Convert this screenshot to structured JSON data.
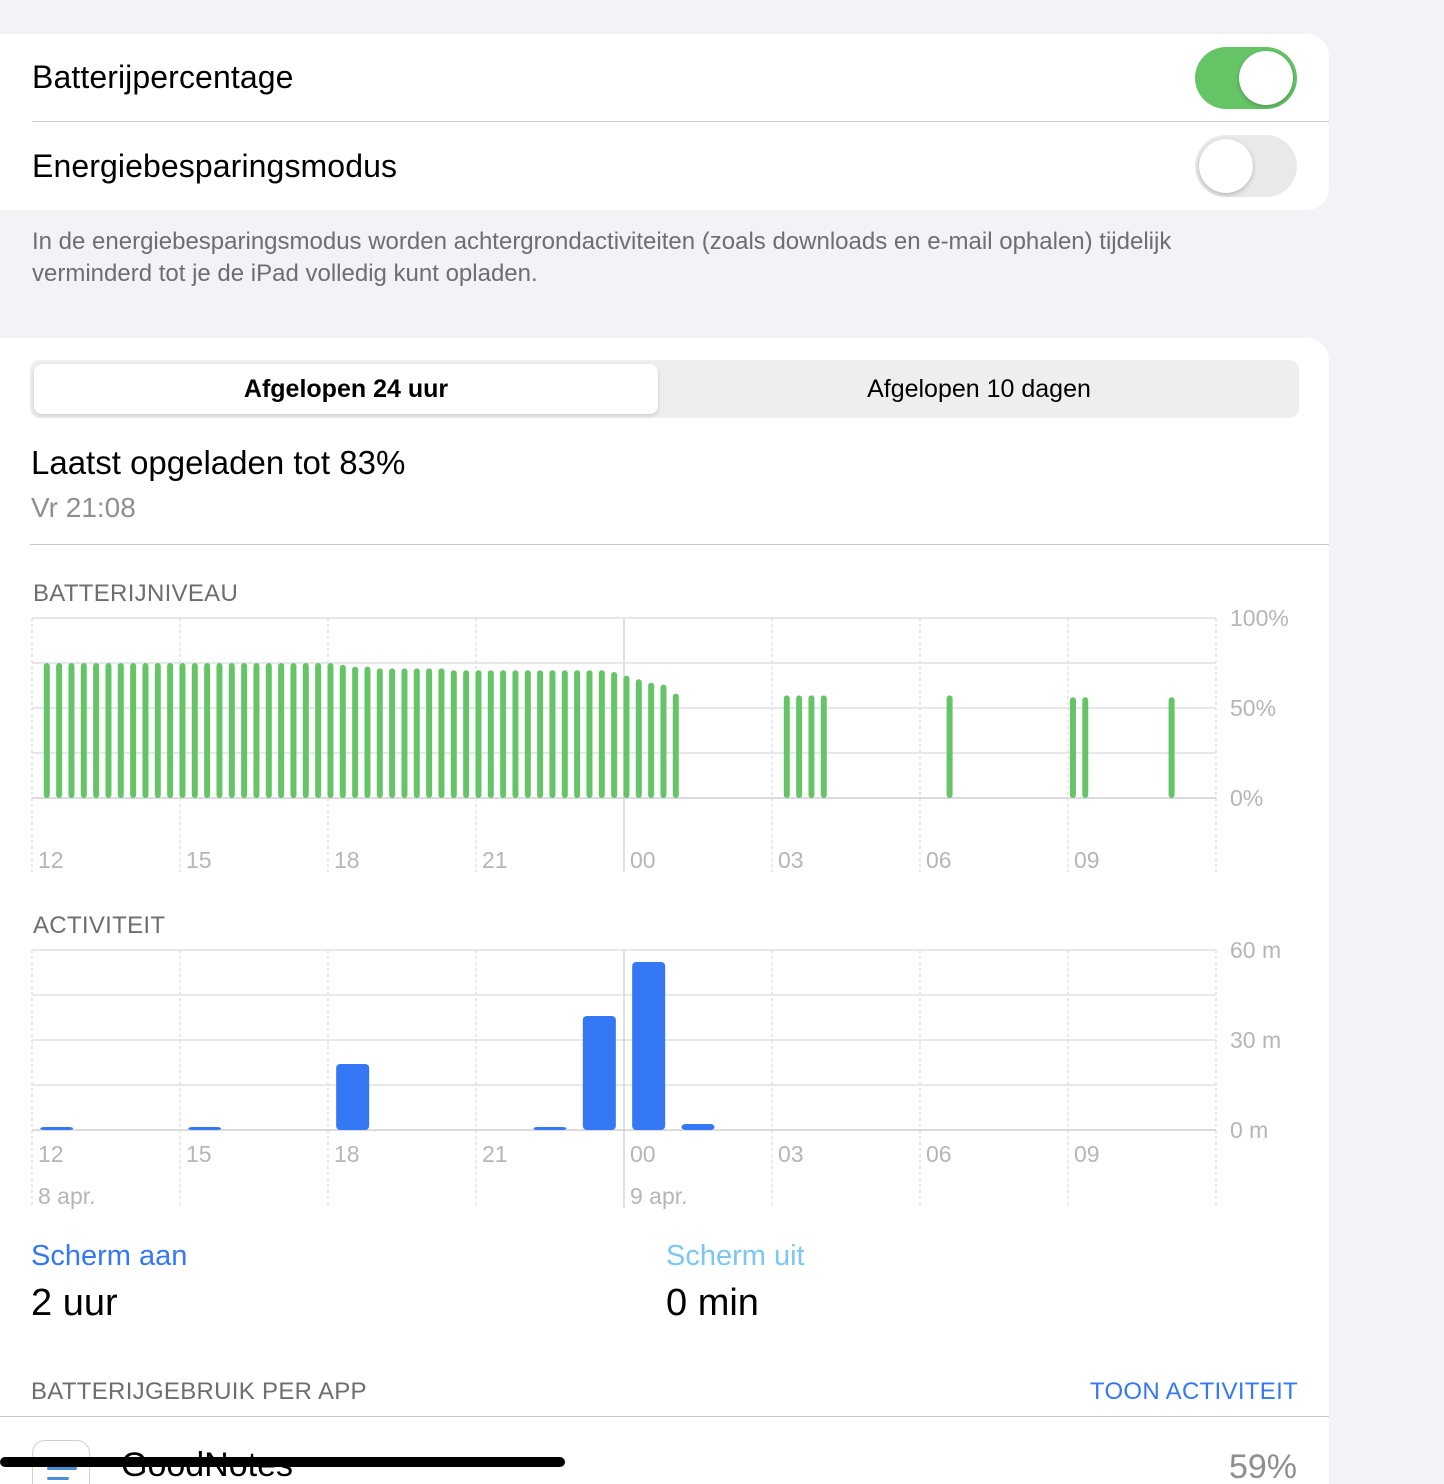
{
  "settings": {
    "battery_percentage": {
      "label": "Batterijpercentage",
      "enabled": true
    },
    "low_power_mode": {
      "label": "Energiebesparingsmodus",
      "enabled": false
    },
    "footnote": "In de energiebesparingsmodus worden achtergrondactiviteiten (zoals downloads en e-mail ophalen) tijdelijk verminderd tot je de iPad volledig kunt opladen."
  },
  "segmented": {
    "options": [
      "Afgelopen 24 uur",
      "Afgelopen 10 dagen"
    ],
    "selected": "Afgelopen 24 uur"
  },
  "last_charge": {
    "title": "Laatst opgeladen tot 83%",
    "time": "Vr 21:08"
  },
  "colors": {
    "battery_bar": "#65c466",
    "activity_bar": "#3478f6",
    "screen_on": "#3478f6",
    "screen_off": "#7cc6f5",
    "link": "#3478f6"
  },
  "chart_data": [
    {
      "type": "bar",
      "title": "BATTERIJNIVEAU",
      "x_ticks": [
        "12",
        "15",
        "18",
        "21",
        "00",
        "03",
        "06",
        "09"
      ],
      "y_ticks": [
        "100%",
        "50%",
        "0%"
      ],
      "ylim": [
        0,
        100
      ],
      "x_unit": "hours since 12:00",
      "grid": true,
      "points": [
        {
          "x": 0.3,
          "y": 75
        },
        {
          "x": 0.55,
          "y": 75
        },
        {
          "x": 0.8,
          "y": 75
        },
        {
          "x": 1.05,
          "y": 75
        },
        {
          "x": 1.3,
          "y": 75
        },
        {
          "x": 1.55,
          "y": 75
        },
        {
          "x": 1.8,
          "y": 75
        },
        {
          "x": 2.05,
          "y": 75
        },
        {
          "x": 2.3,
          "y": 75
        },
        {
          "x": 2.55,
          "y": 75
        },
        {
          "x": 2.8,
          "y": 75
        },
        {
          "x": 3.05,
          "y": 75
        },
        {
          "x": 3.3,
          "y": 75
        },
        {
          "x": 3.55,
          "y": 75
        },
        {
          "x": 3.8,
          "y": 75
        },
        {
          "x": 4.05,
          "y": 75
        },
        {
          "x": 4.3,
          "y": 75
        },
        {
          "x": 4.55,
          "y": 75
        },
        {
          "x": 4.8,
          "y": 75
        },
        {
          "x": 5.05,
          "y": 75
        },
        {
          "x": 5.3,
          "y": 75
        },
        {
          "x": 5.55,
          "y": 75
        },
        {
          "x": 5.8,
          "y": 75
        },
        {
          "x": 6.05,
          "y": 75
        },
        {
          "x": 6.3,
          "y": 74
        },
        {
          "x": 6.55,
          "y": 73
        },
        {
          "x": 6.8,
          "y": 73
        },
        {
          "x": 7.05,
          "y": 72
        },
        {
          "x": 7.3,
          "y": 72
        },
        {
          "x": 7.55,
          "y": 72
        },
        {
          "x": 7.8,
          "y": 72
        },
        {
          "x": 8.05,
          "y": 72
        },
        {
          "x": 8.3,
          "y": 72
        },
        {
          "x": 8.55,
          "y": 71
        },
        {
          "x": 8.8,
          "y": 71
        },
        {
          "x": 9.05,
          "y": 71
        },
        {
          "x": 9.3,
          "y": 71
        },
        {
          "x": 9.55,
          "y": 71
        },
        {
          "x": 9.8,
          "y": 71
        },
        {
          "x": 10.05,
          "y": 71
        },
        {
          "x": 10.3,
          "y": 71
        },
        {
          "x": 10.55,
          "y": 71
        },
        {
          "x": 10.8,
          "y": 71
        },
        {
          "x": 11.05,
          "y": 71
        },
        {
          "x": 11.3,
          "y": 71
        },
        {
          "x": 11.55,
          "y": 71
        },
        {
          "x": 11.8,
          "y": 70
        },
        {
          "x": 12.05,
          "y": 68
        },
        {
          "x": 12.3,
          "y": 66
        },
        {
          "x": 12.55,
          "y": 64
        },
        {
          "x": 12.8,
          "y": 63
        },
        {
          "x": 13.05,
          "y": 58
        },
        {
          "x": 15.3,
          "y": 57
        },
        {
          "x": 15.55,
          "y": 57
        },
        {
          "x": 15.8,
          "y": 57
        },
        {
          "x": 16.05,
          "y": 57
        },
        {
          "x": 18.6,
          "y": 57
        },
        {
          "x": 21.1,
          "y": 56
        },
        {
          "x": 21.35,
          "y": 56
        },
        {
          "x": 23.1,
          "y": 56
        }
      ]
    },
    {
      "type": "bar",
      "title": "ACTIVITEIT",
      "x_ticks": [
        "12",
        "15",
        "18",
        "21",
        "00",
        "03",
        "06",
        "09"
      ],
      "x_day_labels": [
        "8 apr.",
        "9 apr."
      ],
      "y_ticks": [
        "60 m",
        "30 m",
        "0 m"
      ],
      "ylim": [
        0,
        60
      ],
      "x_unit": "hours since 12:00",
      "grid": true,
      "points": [
        {
          "x": 0.5,
          "y": 1
        },
        {
          "x": 3.5,
          "y": 1
        },
        {
          "x": 6.5,
          "y": 22
        },
        {
          "x": 10.5,
          "y": 1
        },
        {
          "x": 11.5,
          "y": 38
        },
        {
          "x": 12.5,
          "y": 56
        },
        {
          "x": 13.5,
          "y": 2
        }
      ]
    }
  ],
  "activity_stats": {
    "screen_on": {
      "label": "Scherm aan",
      "value": "2 uur"
    },
    "screen_off": {
      "label": "Scherm uit",
      "value": "0 min"
    }
  },
  "app_usage": {
    "header": "BATTERIJGEBRUIK PER APP",
    "action": "TOON ACTIVITEIT",
    "apps": [
      {
        "name": "GoodNotes",
        "percent": "59%",
        "icon": "goodnotes-icon"
      }
    ]
  }
}
